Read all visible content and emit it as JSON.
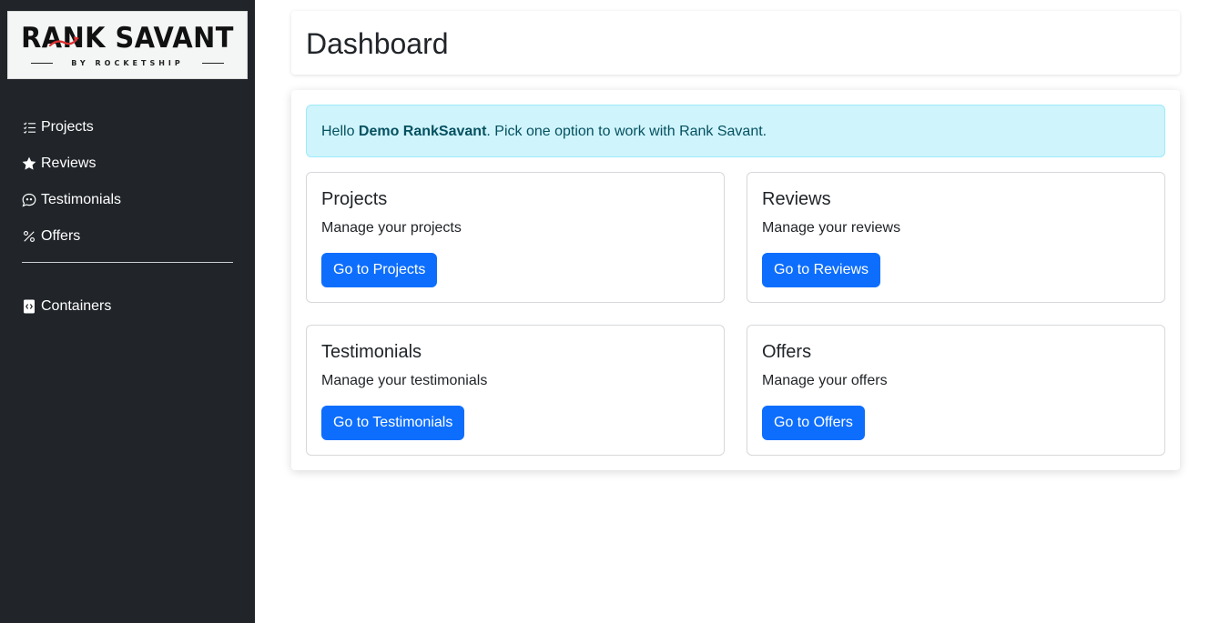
{
  "brand": {
    "logo_main": "RANK SAVANT",
    "logo_sub": "BY ROCKETSHIP",
    "accent_color": "#e03131"
  },
  "sidebar": {
    "items": [
      {
        "label": "Projects",
        "icon": "list-check-icon"
      },
      {
        "label": "Reviews",
        "icon": "star-icon"
      },
      {
        "label": "Testimonials",
        "icon": "chat-quote-icon"
      },
      {
        "label": "Offers",
        "icon": "percent-icon"
      }
    ],
    "secondary_items": [
      {
        "label": "Containers",
        "icon": "file-code-icon"
      }
    ]
  },
  "header": {
    "title": "Dashboard"
  },
  "alert": {
    "prefix": "Hello ",
    "user_name": "Demo RankSavant",
    "suffix": ". Pick one option to work with Rank Savant."
  },
  "cards": [
    {
      "title": "Projects",
      "text": "Manage your projects",
      "button": "Go to Projects"
    },
    {
      "title": "Reviews",
      "text": "Manage your reviews",
      "button": "Go to Reviews"
    },
    {
      "title": "Testimonials",
      "text": "Manage your testimonials",
      "button": "Go to Testimonials"
    },
    {
      "title": "Offers",
      "text": "Manage your offers",
      "button": "Go to Offers"
    }
  ],
  "colors": {
    "sidebar_bg": "#212529",
    "primary": "#0d6efd",
    "alert_bg": "#cff4fc",
    "alert_text": "#055160"
  }
}
